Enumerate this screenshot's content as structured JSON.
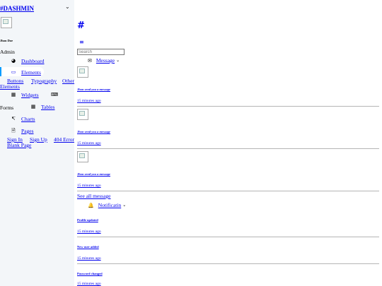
{
  "brand": "#DASHMIN",
  "user": {
    "name": "Jhon Doe",
    "role": "Admin"
  },
  "nav": {
    "dashboard": "Dashboard",
    "elements": "Elements",
    "elements_sub": [
      "Buttons",
      "Typography",
      "Other Elements"
    ],
    "widgets": "Widgets",
    "forms": "Forms",
    "tables": "Tables",
    "charts": "Charts",
    "pages": "Pages",
    "pages_sub": [
      "Sign In",
      "Sign Up",
      "404 Error",
      "Blank Page"
    ]
  },
  "topbar": {
    "logo_hash": "#",
    "search_placeholder": "Search",
    "message_label": "Message",
    "notification_label": "Notificatin",
    "see_all": "See all message"
  },
  "messages": [
    {
      "title": "Jhon send you a message",
      "time": "15 minutes ago"
    },
    {
      "title": "Jhon send you a message",
      "time": "15 minutes ago"
    },
    {
      "title": "Jhon send you a message",
      "time": "15 minutes ago"
    }
  ],
  "notifications": [
    {
      "title": "Profile updated",
      "time": "15 minutes ago"
    },
    {
      "title": "New user added",
      "time": "15 minutes ago"
    },
    {
      "title": "Password changed",
      "time": "15 minutes ago"
    }
  ]
}
